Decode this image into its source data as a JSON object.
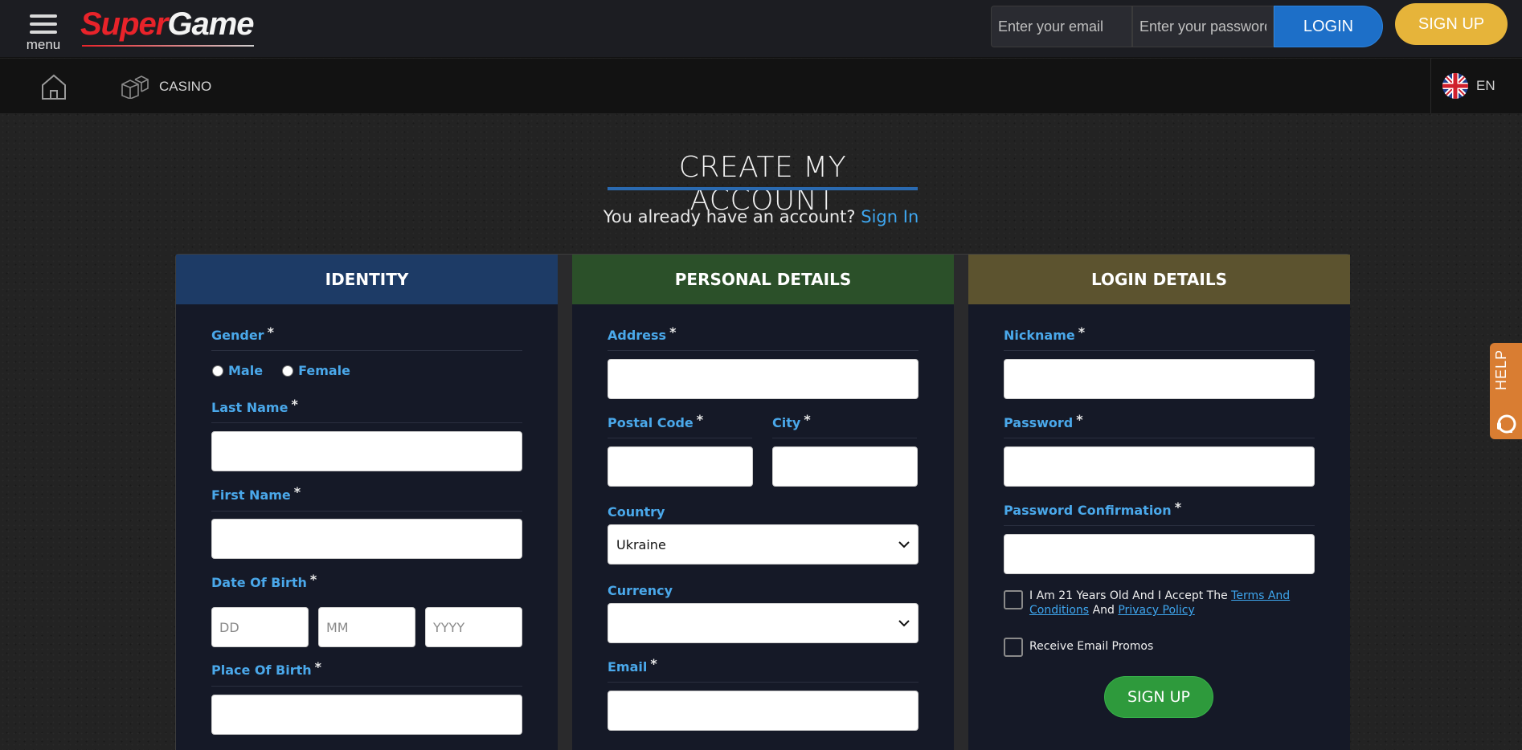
{
  "header": {
    "menu_label": "menu",
    "logo_super": "Super",
    "logo_game": "Game",
    "email_placeholder": "Enter your email",
    "password_placeholder": "Enter your password",
    "login_label": "LOGIN",
    "signup_label": "SIGN UP"
  },
  "nav": {
    "casino_label": "CASINO",
    "language_code": "EN"
  },
  "page": {
    "title": "CREATE MY ACCOUNT",
    "already_text": "You already have an account?",
    "sign_in_link": "Sign In"
  },
  "identity": {
    "header": "IDENTITY",
    "gender_label": "Gender",
    "male_label": "Male",
    "female_label": "Female",
    "last_name_label": "Last Name",
    "first_name_label": "First Name",
    "dob_label": "Date Of Birth",
    "dob_day_placeholder": "DD",
    "dob_month_placeholder": "MM",
    "dob_year_placeholder": "YYYY",
    "place_of_birth_label": "Place Of Birth"
  },
  "personal": {
    "header": "PERSONAL DETAILS",
    "address_label": "Address",
    "postal_code_label": "Postal Code",
    "city_label": "City",
    "country_label": "Country",
    "country_value": "Ukraine",
    "currency_label": "Currency",
    "currency_value": "",
    "email_label": "Email"
  },
  "login": {
    "header": "LOGIN DETAILS",
    "nickname_label": "Nickname",
    "password_label": "Password",
    "password_confirm_label": "Password Confirmation",
    "terms_prefix": "I Am 21 Years Old And I Accept The",
    "terms_link": "Terms And Conditions",
    "terms_and": "And",
    "privacy_link": "Privacy Policy",
    "promos_label": "Receive Email Promos",
    "signup_label": "SIGN UP"
  },
  "required_mark": "*",
  "help_label": "HELP",
  "colors": {
    "identity_header": "#1d3b66",
    "personal_header": "#2b5029",
    "login_header": "#5c532f",
    "accent_blue": "#1d6fc8",
    "signup_gold": "#e6b43a",
    "signup_green": "#2e9a3c",
    "label_blue": "#4aa8ea",
    "help_orange": "#d97d32"
  },
  "icons": [
    "menu-icon",
    "home-icon",
    "dice-icon",
    "uk-flag-icon",
    "chevron-down-icon",
    "headset-icon"
  ]
}
